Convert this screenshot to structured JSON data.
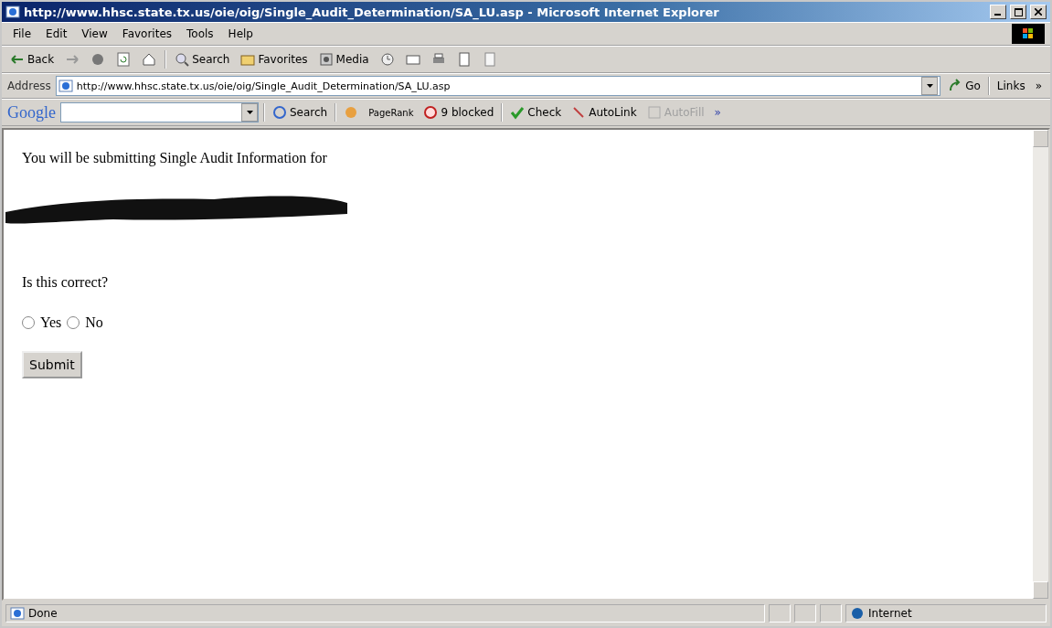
{
  "window": {
    "title": "http://www.hhsc.state.tx.us/oie/oig/Single_Audit_Determination/SA_LU.asp - Microsoft Internet Explorer"
  },
  "menu": [
    "File",
    "Edit",
    "View",
    "Favorites",
    "Tools",
    "Help"
  ],
  "toolbar": {
    "back": "Back",
    "search": "Search",
    "favorites": "Favorites",
    "media": "Media"
  },
  "address": {
    "label": "Address",
    "url": "http://www.hhsc.state.tx.us/oie/oig/Single_Audit_Determination/SA_LU.asp",
    "go": "Go",
    "links": "Links",
    "more": "»"
  },
  "google_bar": {
    "logo": "Google",
    "search": "Search",
    "pagerank": "PageRank",
    "blocked": "9 blocked",
    "check": "Check",
    "autolink": "AutoLink",
    "autofill": "AutoFill",
    "more": "»"
  },
  "content": {
    "intro": "You will be submitting Single Audit Information for",
    "question": "Is this correct?",
    "options": [
      {
        "label": "Yes",
        "selected": false
      },
      {
        "label": "No",
        "selected": false
      }
    ],
    "submit": "Submit"
  },
  "status_bar": {
    "status": "Done",
    "zone": "Internet"
  }
}
